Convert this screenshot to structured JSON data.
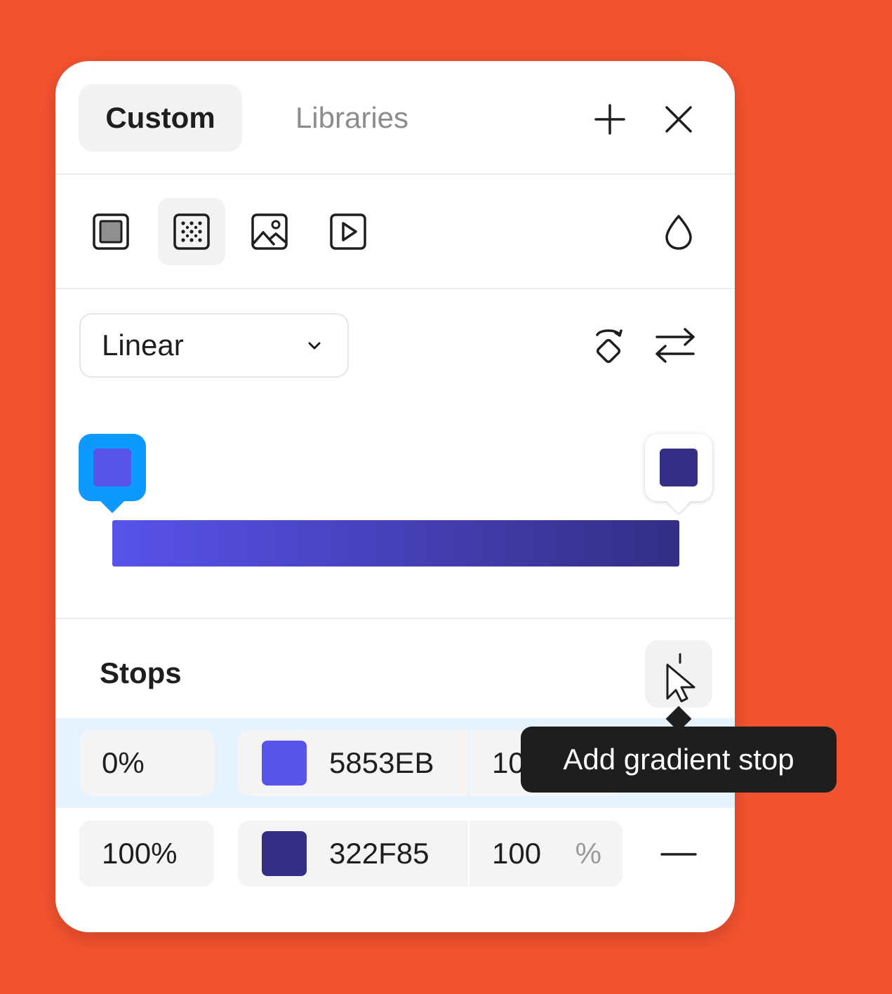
{
  "tabs": [
    {
      "label": "Custom",
      "active": true
    },
    {
      "label": "Libraries",
      "active": false
    }
  ],
  "header_actions": {
    "add_icon": "plus-icon",
    "close_icon": "close-icon"
  },
  "fill_types": [
    {
      "name": "solid",
      "icon": "solid-fill-icon",
      "selected": false
    },
    {
      "name": "gradient",
      "icon": "gradient-fill-icon",
      "selected": true
    },
    {
      "name": "image",
      "icon": "image-fill-icon",
      "selected": false
    },
    {
      "name": "video",
      "icon": "video-fill-icon",
      "selected": false
    }
  ],
  "blend_icon": "droplet-icon",
  "gradient": {
    "type": "Linear",
    "rotate_icon": "rotate-icon",
    "flip_icon": "swap-arrows-icon",
    "start_color": "#5853EB",
    "end_color": "#322F85",
    "handle_accent": "#0D99FF"
  },
  "stops": {
    "label": "Stops",
    "add_icon": "add-stop-cursor-icon",
    "tooltip": "Add gradient stop",
    "items": [
      {
        "position": "0%",
        "hex": "5853EB",
        "color": "#5853EB",
        "opacity": "10",
        "unit": "%",
        "selected": true
      },
      {
        "position": "100%",
        "hex": "322F85",
        "color": "#322F85",
        "opacity": "100",
        "unit": "%",
        "selected": false
      }
    ],
    "remove_icon": "minus-icon"
  },
  "colors": {
    "background": "#F4532F",
    "selection": "#E5F3FF"
  }
}
